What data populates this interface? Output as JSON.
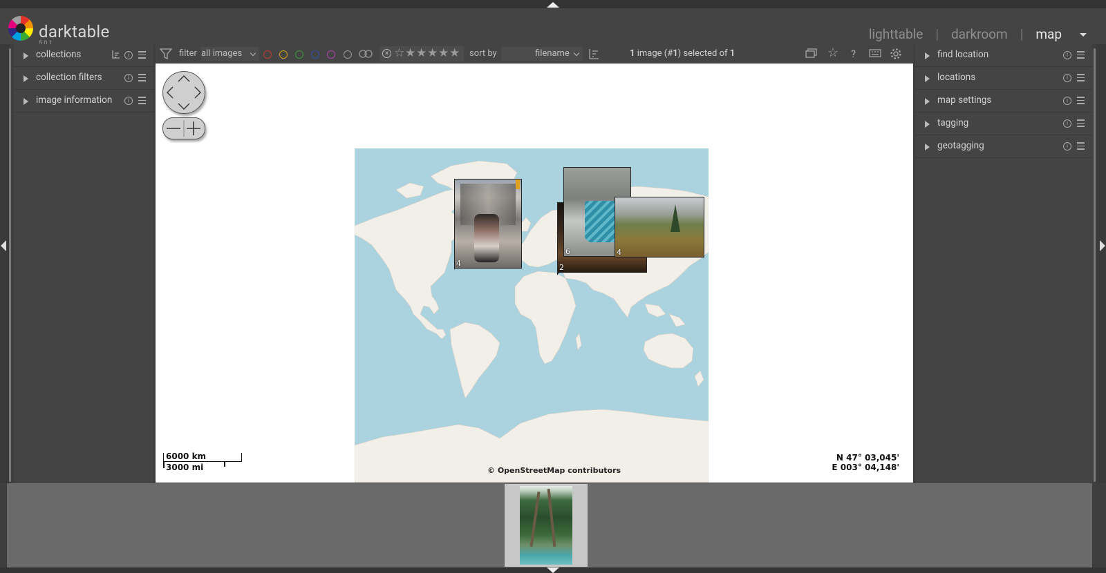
{
  "app": {
    "name": "darktable",
    "version": "5.0.1"
  },
  "views": {
    "lighttable": "lighttable",
    "darkroom": "darkroom",
    "map": "map",
    "separator": "|"
  },
  "left_modules": [
    {
      "label": "collections"
    },
    {
      "label": "collection filters"
    },
    {
      "label": "image information"
    }
  ],
  "right_modules": [
    {
      "label": "find location"
    },
    {
      "label": "locations"
    },
    {
      "label": "map settings"
    },
    {
      "label": "tagging"
    },
    {
      "label": "geotagging"
    }
  ],
  "toolbar": {
    "filter_label": "filter",
    "filter_value": "all images",
    "color_labels": [
      "#c0392b",
      "#d4a017",
      "#3a9a3a",
      "#3050b0",
      "#b040b0"
    ],
    "sort_label": "sort by",
    "sort_value": "filename",
    "selection_count": "1",
    "selection_mid": " image (#",
    "selection_id": "1",
    "selection_tail": ") selected of ",
    "selection_total": "1"
  },
  "map": {
    "scale_km": "6000 km",
    "scale_mi": "3000 mi",
    "coord_lat": "N 47° 03,045'",
    "coord_lon": "E 003° 04,148'",
    "attribution": "© OpenStreetMap contributors",
    "pins": [
      {
        "count": "4",
        "subject": "street-photo"
      },
      {
        "count": "2",
        "subject": "cafe-photo"
      },
      {
        "count": "6",
        "subject": "cup-photo"
      },
      {
        "count": "4",
        "subject": "landscape-photo"
      }
    ]
  },
  "filmstrip": {
    "thumb": "palm-trees-photo"
  }
}
